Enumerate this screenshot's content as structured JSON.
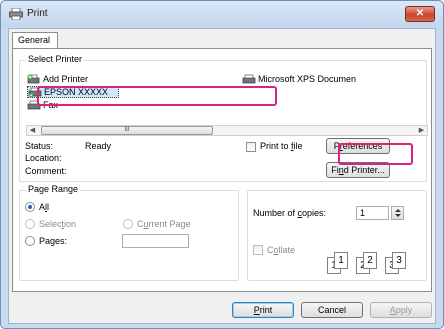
{
  "window": {
    "title": "Print",
    "close_glyph": "✕"
  },
  "tabs": [
    {
      "label": "General"
    }
  ],
  "select_printer": {
    "legend": "Select Printer",
    "printers": [
      {
        "label": "Add Printer",
        "icon": "add-printer-icon"
      },
      {
        "label": "EPSON XXXXX",
        "icon": "printer-icon",
        "selected": true
      },
      {
        "label": "Fax",
        "icon": "fax-icon"
      },
      {
        "label": "Microsoft XPS Documen",
        "icon": "printer-icon"
      }
    ],
    "scroll_thumb_grip": "III",
    "status_label": "Status:",
    "status_value": "Ready",
    "location_label": "Location:",
    "comment_label": "Comment:",
    "print_to_file": {
      "prefix": "Print to ",
      "accel": "f",
      "suffix": "ile",
      "checked": false
    },
    "preferences_button": {
      "prefix": "P",
      "accel": "r",
      "suffix": "eferences"
    },
    "find_printer_button": {
      "prefix": "Fi",
      "accel": "n",
      "suffix": "d Printer..."
    }
  },
  "page_range": {
    "legend": "Page Range",
    "all": {
      "prefix": "A",
      "accel": "l",
      "suffix": "l",
      "checked": true
    },
    "selection": {
      "prefix": "Selec",
      "accel": "t",
      "suffix": "ion"
    },
    "current_page": {
      "prefix": "C",
      "accel": "u",
      "suffix": "rrent Page"
    },
    "pages": {
      "prefix": "Pa",
      "accel": "g",
      "suffix": "es:",
      "value": ""
    }
  },
  "copies": {
    "label": {
      "prefix": "Number of ",
      "accel": "c",
      "suffix": "opies:"
    },
    "value": "1",
    "collate": {
      "prefix": "C",
      "accel": "o",
      "suffix": "llate",
      "checked": false
    },
    "collate_pages": [
      "1",
      "1",
      "2",
      "2",
      "3",
      "3"
    ]
  },
  "buttons": {
    "print": {
      "prefix": "",
      "accel": "P",
      "suffix": "rint"
    },
    "cancel": "Cancel",
    "apply": {
      "prefix": "",
      "accel": "A",
      "suffix": "pply"
    }
  },
  "colors": {
    "highlight": "#e0207e",
    "selection": "#cfe6fb",
    "title_close": "#c7462b"
  }
}
